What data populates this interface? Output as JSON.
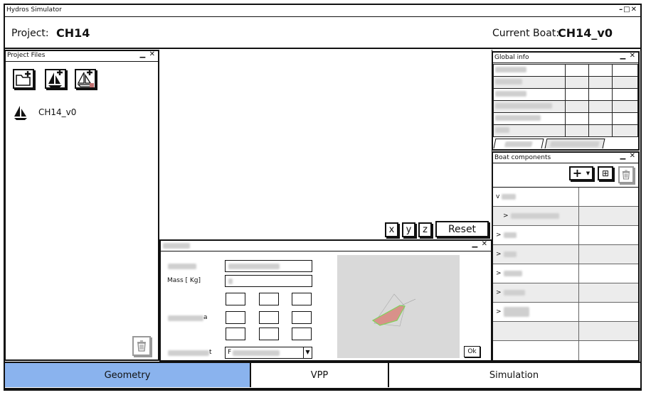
{
  "window": {
    "title": "Hydros Simulator",
    "controls": "–□✕"
  },
  "header": {
    "project_label": "Project:",
    "project_value": "CH14",
    "boat_label": "Current Boat:",
    "boat_value": "CH14_v0"
  },
  "project_files": {
    "title": "Project Files",
    "items": [
      {
        "label": "CH14_v0",
        "icon": "sailboat-icon"
      }
    ]
  },
  "viewport": {
    "axis_buttons": [
      "x",
      "y",
      "z"
    ],
    "reset_label": "Reset"
  },
  "bottom_panel": {
    "mass_label": "Mass [ Kg]",
    "ok_label": "Ok"
  },
  "global_info": {
    "title": "Global info"
  },
  "boat_components": {
    "title": "Boat components",
    "add_label": "+"
  },
  "tabs": [
    {
      "label": "Geometry",
      "active": true
    },
    {
      "label": "VPP",
      "active": false
    },
    {
      "label": "Simulation",
      "active": false
    }
  ],
  "colors": {
    "active_tab": "#8ab3ee",
    "render_bg": "#d9d9d9",
    "shape_fill": "#d8918a",
    "shape_edge": "#7fd45a"
  }
}
